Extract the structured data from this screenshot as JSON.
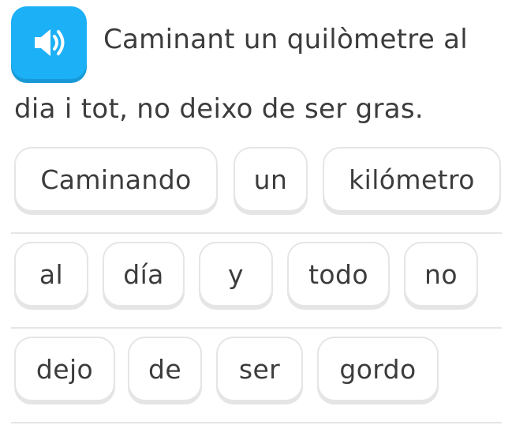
{
  "audio_button": {
    "icon": "speaker-icon",
    "color": "#1cb0f6"
  },
  "prompt": {
    "line1": "Caminant un quilòmetre al",
    "line2": "dia i tot, no deixo de ser gras."
  },
  "word_bank": {
    "row1": [
      "Caminando",
      "un",
      "kilómetro"
    ],
    "row2": [
      "al",
      "día",
      "y",
      "todo",
      "no"
    ],
    "row3": [
      "dejo",
      "de",
      "ser",
      "gordo"
    ]
  }
}
